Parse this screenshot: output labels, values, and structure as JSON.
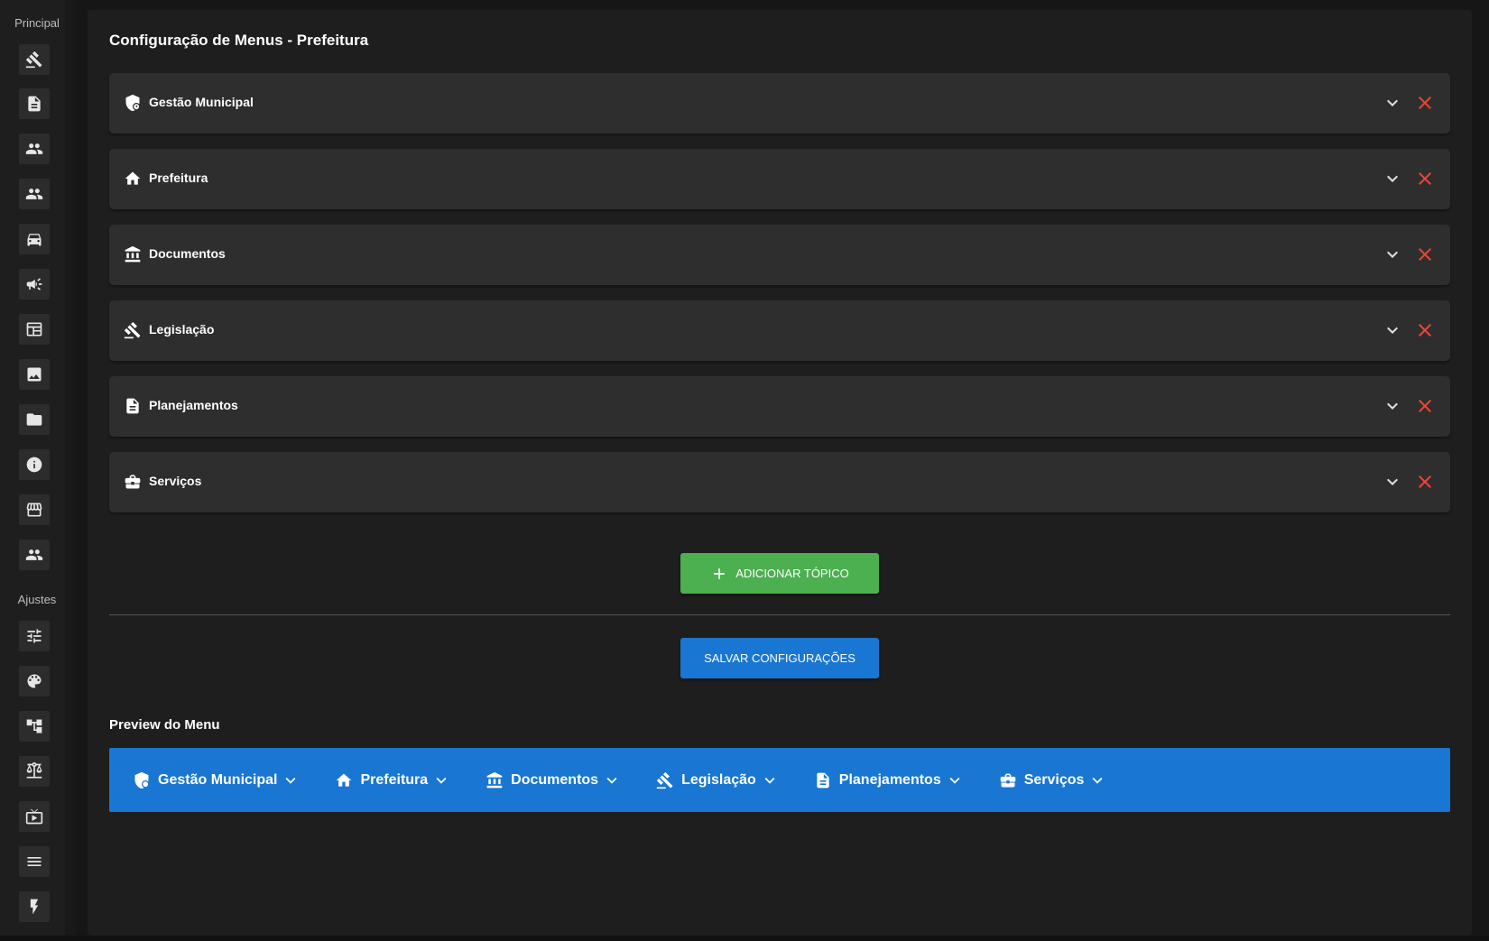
{
  "sidebar": {
    "section_principal": "Principal",
    "section_ajustes": "Ajustes",
    "principal_items": [
      {
        "icon": "gavel-icon"
      },
      {
        "icon": "document-icon"
      },
      {
        "icon": "people-icon"
      },
      {
        "icon": "people-icon"
      },
      {
        "icon": "car-icon"
      },
      {
        "icon": "megaphone-icon"
      },
      {
        "icon": "table-icon"
      },
      {
        "icon": "image-icon"
      },
      {
        "icon": "folder-icon"
      },
      {
        "icon": "info-icon"
      },
      {
        "icon": "store-icon"
      },
      {
        "icon": "people-icon"
      }
    ],
    "ajustes_items": [
      {
        "icon": "sliders-icon"
      },
      {
        "icon": "palette-icon"
      },
      {
        "icon": "sitemap-icon"
      },
      {
        "icon": "scale-icon"
      },
      {
        "icon": "tv-icon"
      },
      {
        "icon": "menu-icon"
      },
      {
        "icon": "flash-icon"
      }
    ]
  },
  "main": {
    "title": "Configuração de Menus - Prefeitura",
    "topics": [
      {
        "label": "Gestão Municipal",
        "icon": "shield-icon"
      },
      {
        "label": "Prefeitura",
        "icon": "home-icon"
      },
      {
        "label": "Documentos",
        "icon": "bank-icon"
      },
      {
        "label": "Legislação",
        "icon": "gavel-icon"
      },
      {
        "label": "Planejamentos",
        "icon": "document-icon"
      },
      {
        "label": "Serviços",
        "icon": "briefcase-icon"
      }
    ],
    "add_topic_label": "ADICIONAR TÓPICO",
    "save_label": "SALVAR CONFIGURAÇÕES",
    "preview_title": "Preview do Menu",
    "preview_items": [
      {
        "label": "Gestão Municipal",
        "icon": "shield-icon"
      },
      {
        "label": "Prefeitura",
        "icon": "home-icon"
      },
      {
        "label": "Documentos",
        "icon": "bank-icon"
      },
      {
        "label": "Legislação",
        "icon": "gavel-icon"
      },
      {
        "label": "Planejamentos",
        "icon": "document-icon"
      },
      {
        "label": "Serviços",
        "icon": "briefcase-icon"
      }
    ]
  },
  "colors": {
    "accent_blue": "#1976d2",
    "add_green": "#4caf50",
    "delete_red": "#f44336",
    "card_bg": "#2e2e2e",
    "panel_bg": "#1e1e1e"
  }
}
